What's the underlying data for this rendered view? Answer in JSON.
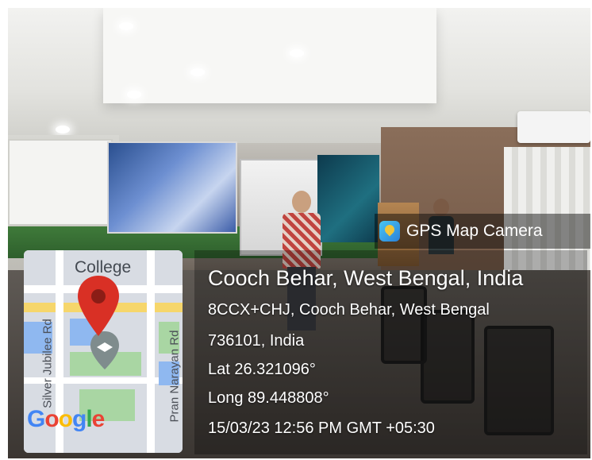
{
  "app": {
    "name": "GPS Map Camera",
    "icon": "gps-map-camera-icon"
  },
  "location": {
    "title": "Cooch Behar, West Bengal, India",
    "address_line1": "8CCX+CHJ, Cooch Behar, West Bengal",
    "address_line2": "736101, India",
    "latitude": "Lat 26.321096°",
    "longitude": "Long 89.448808°",
    "timestamp": "15/03/23 12:56 PM GMT +05:30"
  },
  "map": {
    "place_label": "College",
    "road_label_1": "Silver Jubilee Rd",
    "road_label_2": "Pran Narayan Rd",
    "logo": [
      "G",
      "o",
      "o",
      "g",
      "l",
      "e"
    ],
    "logo_colors": [
      "#4285f4",
      "#ea4335",
      "#fbbc05",
      "#4285f4",
      "#34a853",
      "#ea4335"
    ],
    "pin_color": "#d93025"
  }
}
